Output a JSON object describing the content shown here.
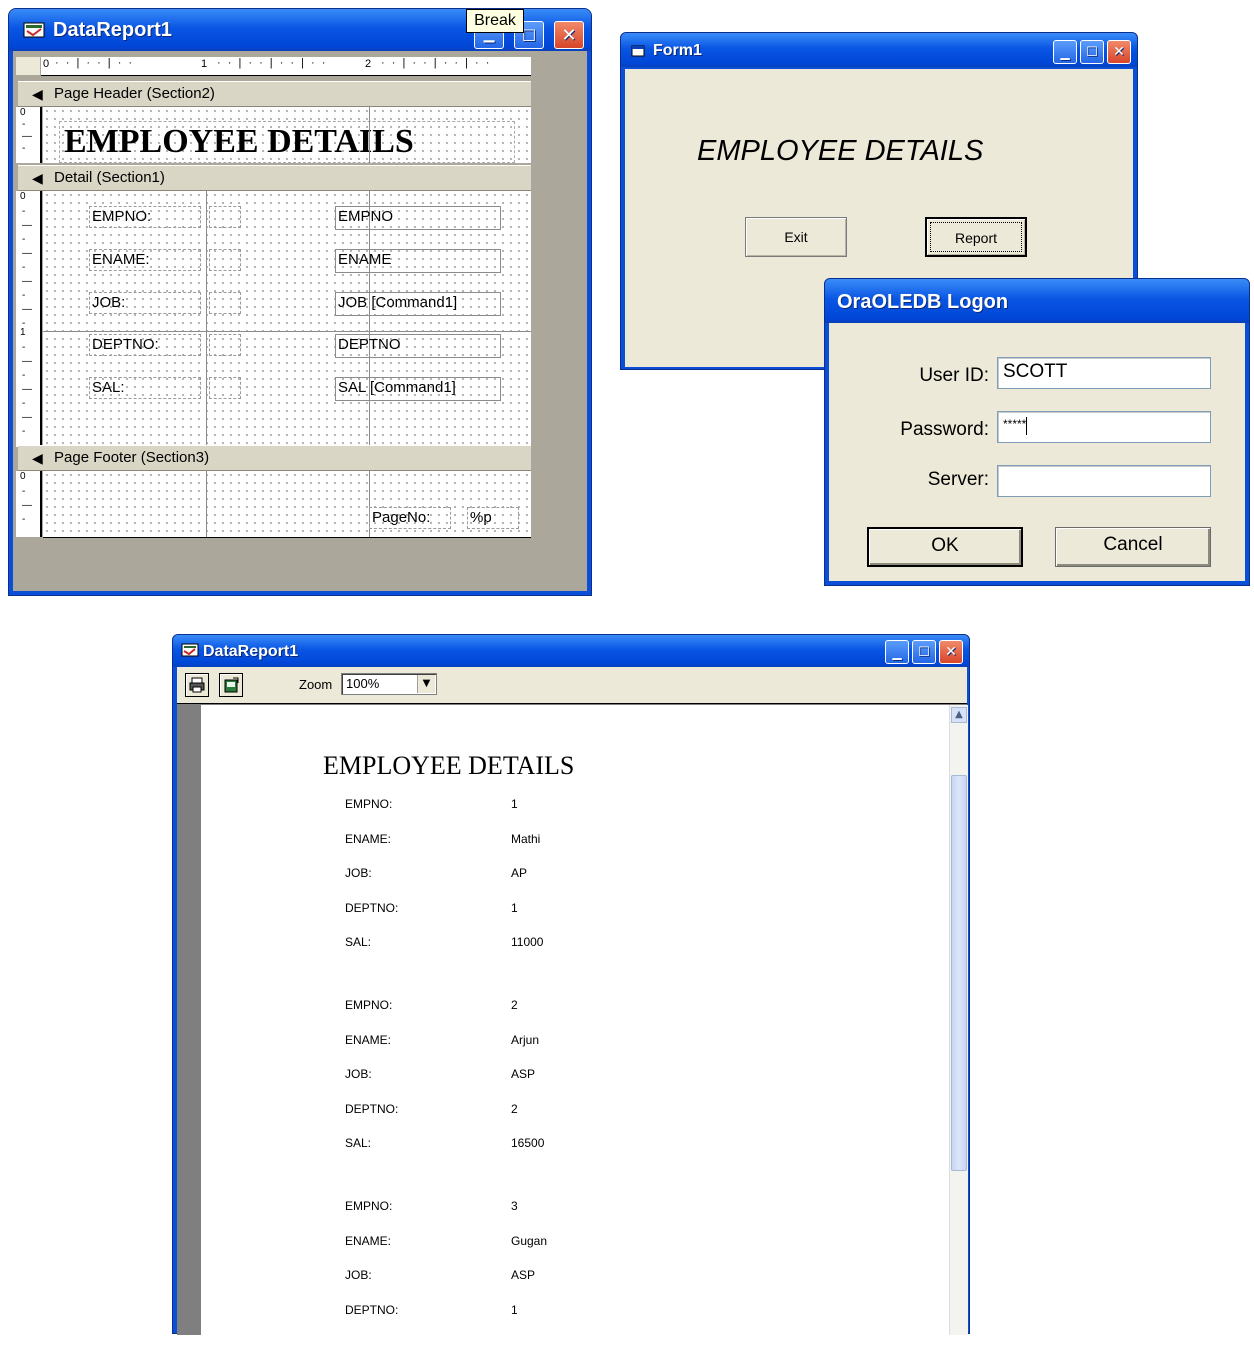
{
  "designer": {
    "title": "DataReport1",
    "tooltip": "Break",
    "ruler_marks": [
      "0",
      "1",
      "2"
    ],
    "vruler_header": "0",
    "vruler_detail_0": "0",
    "vruler_detail_1": "1",
    "vruler_footer": "0",
    "sections": {
      "page_header": "Page Header (Section2)",
      "detail": "Detail (Section1)",
      "page_footer": "Page Footer (Section3)"
    },
    "header_title": "EMPLOYEE DETAILS",
    "detail_rows": [
      {
        "label": "EMPNO:",
        "field": "EMPNO"
      },
      {
        "label": "ENAME:",
        "field": "ENAME"
      },
      {
        "label": "JOB:",
        "field": "JOB [Command1]"
      },
      {
        "label": "DEPTNO:",
        "field": "DEPTNO"
      },
      {
        "label": "SAL:",
        "field": "SAL [Command1]"
      }
    ],
    "footer_label": "PageNo:",
    "footer_field": "%p"
  },
  "form1": {
    "title": "Form1",
    "heading": "EMPLOYEE DETAILS",
    "exit_label": "Exit",
    "report_label": "Report"
  },
  "logon": {
    "title": "OraOLEDB Logon",
    "userid_label": "User ID:",
    "userid_value": "SCOTT",
    "password_label": "Password:",
    "password_value": "*****",
    "server_label": "Server:",
    "server_value": "",
    "ok_label": "OK",
    "cancel_label": "Cancel"
  },
  "preview": {
    "title": "DataReport1",
    "zoom_label": "Zoom",
    "zoom_value": "100%",
    "report_title": "EMPLOYEE DETAILS",
    "records": [
      {
        "EMPNO:": "1",
        "ENAME:": "Mathi",
        "JOB:": "AP",
        "DEPTNO:": "1",
        "SAL:": "11000"
      },
      {
        "EMPNO:": "2",
        "ENAME:": "Arjun",
        "JOB:": "ASP",
        "DEPTNO:": "2",
        "SAL:": "16500"
      },
      {
        "EMPNO:": "3",
        "ENAME:": "Gugan",
        "JOB:": "ASP",
        "DEPTNO:": "1"
      }
    ],
    "field_labels": [
      "EMPNO:",
      "ENAME:",
      "JOB:",
      "DEPTNO:",
      "SAL:"
    ]
  },
  "colors": {
    "xp_title": "#0a56e4",
    "xp_client": "#ece9d8",
    "close_button": "#d8452a",
    "designer_bg": "#aba89b"
  }
}
